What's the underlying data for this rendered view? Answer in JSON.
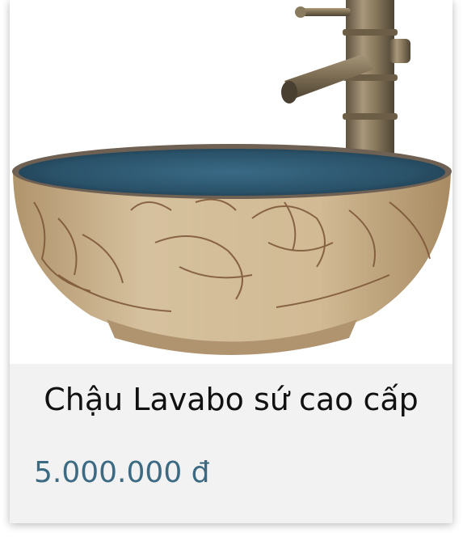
{
  "product": {
    "title": "Chậu Lavabo sứ cao cấp",
    "price": "5.000.000 đ",
    "image_icon": "ceramic-basin-image"
  },
  "colors": {
    "price": "#3d6a83",
    "info_background": "#f2f2f2",
    "basin_glaze": "#2b5670",
    "basin_body": "#c9b08a",
    "faucet_brass": "#8c7a5c"
  }
}
